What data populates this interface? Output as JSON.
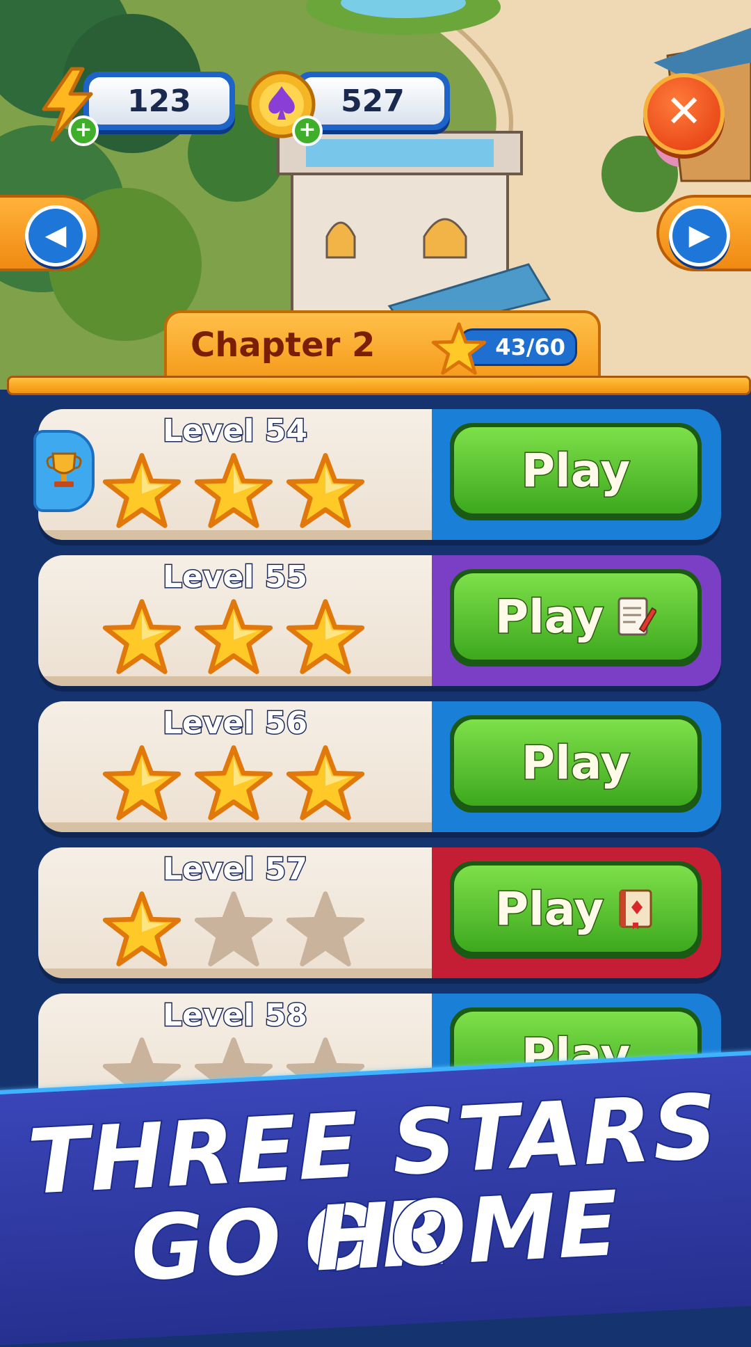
{
  "hud": {
    "energy": "123",
    "coins": "527",
    "plus_label": "+",
    "close_label": "✕"
  },
  "navigation": {
    "prev_arrow": "◀",
    "next_arrow": "▶"
  },
  "chapter": {
    "title": "Chapter 2",
    "stars_progress": "43/60"
  },
  "levels": [
    {
      "label": "Level 54",
      "stars": 3,
      "button": "Play",
      "accent": "#1a7fd6",
      "extra_icon": "none"
    },
    {
      "label": "Level 55",
      "stars": 3,
      "button": "Play",
      "accent": "#7b3fc6",
      "extra_icon": "notepad-icon"
    },
    {
      "label": "Level 56",
      "stars": 3,
      "button": "Play",
      "accent": "#1a7fd6",
      "extra_icon": "none"
    },
    {
      "label": "Level 57",
      "stars": 1,
      "button": "Play",
      "accent": "#c41e35",
      "extra_icon": "book-icon"
    },
    {
      "label": "Level 58",
      "stars": 0,
      "button": "Play",
      "accent": "#1a7fd6",
      "extra_icon": "none"
    }
  ],
  "promo": {
    "line1": "THREE STARS OR",
    "line2": "GO HOME"
  },
  "colors": {
    "star_filled": "#ffc928",
    "star_empty": "#c9b39c",
    "play_green": "#4cba24",
    "background": "#14336f"
  }
}
